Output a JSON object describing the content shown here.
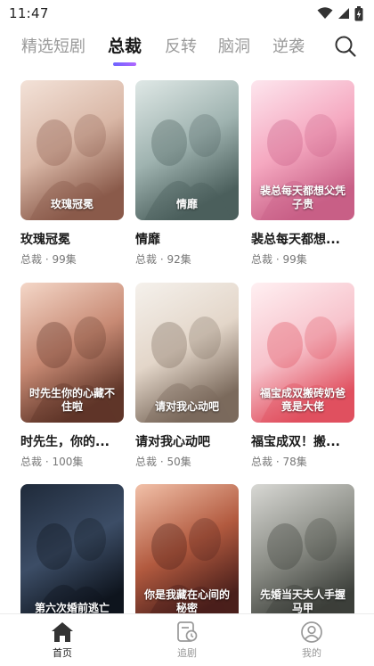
{
  "status": {
    "time": "11:47"
  },
  "tabs": [
    {
      "label": "精选短剧",
      "active": false
    },
    {
      "label": "总裁",
      "active": true
    },
    {
      "label": "反转",
      "active": false
    },
    {
      "label": "脑洞",
      "active": false
    },
    {
      "label": "逆袭",
      "active": false
    }
  ],
  "cards": [
    {
      "title": "玫瑰冠冕",
      "meta": "总裁 · 99集",
      "poster_text": "玫瑰冠冕",
      "colors": [
        "#f3e2d8",
        "#d9b7a6",
        "#8a5a4a"
      ]
    },
    {
      "title": "情靡",
      "meta": "总裁 · 92集",
      "poster_text": "情靡",
      "colors": [
        "#dfe8e6",
        "#9fb3b0",
        "#4b5f5c"
      ]
    },
    {
      "title": "裴总每天都想...",
      "meta": "总裁 · 99集",
      "poster_text": "裴总每天都想父凭子贵",
      "colors": [
        "#fde6ee",
        "#f5a8c0",
        "#c85f86"
      ]
    },
    {
      "title": "时先生，你的...",
      "meta": "总裁 · 100集",
      "poster_text": "时先生你的心藏不住啦",
      "colors": [
        "#f4d7c8",
        "#c88a74",
        "#5f3528"
      ]
    },
    {
      "title": "请对我心动吧",
      "meta": "总裁 · 50集",
      "poster_text": "请对我心动吧",
      "colors": [
        "#f5f1ec",
        "#e3d6c9",
        "#7b6a5c"
      ]
    },
    {
      "title": "福宝成双！搬...",
      "meta": "总裁 · 78集",
      "poster_text": "福宝成双搬砖奶爸竟是大佬",
      "colors": [
        "#fff0f2",
        "#f7c3cc",
        "#e0505f"
      ]
    },
    {
      "title": "",
      "meta": "",
      "poster_text": "第六次婚前逃亡",
      "colors": [
        "#1f2a3a",
        "#3c4d66",
        "#0e141d"
      ]
    },
    {
      "title": "",
      "meta": "",
      "poster_text": "你是我藏在心间的秘密",
      "colors": [
        "#f2c1a9",
        "#b25a3f",
        "#4a1f1b"
      ]
    },
    {
      "title": "",
      "meta": "",
      "poster_text": "先婚当天夫人手握马甲",
      "colors": [
        "#d8d8d4",
        "#8b8d86",
        "#3c3f3a"
      ]
    }
  ],
  "bottom_nav": [
    {
      "label": "首页",
      "icon": "home-icon",
      "active": true
    },
    {
      "label": "追剧",
      "icon": "watchlist-icon",
      "active": false
    },
    {
      "label": "我的",
      "icon": "profile-icon",
      "active": false
    }
  ]
}
